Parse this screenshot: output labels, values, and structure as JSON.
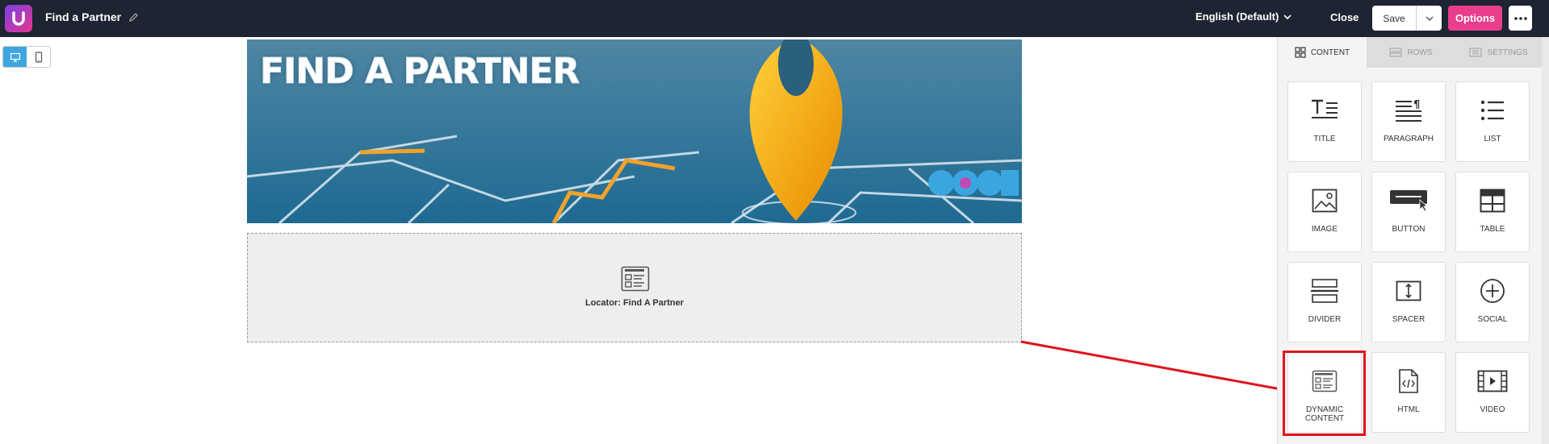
{
  "header": {
    "title": "Find a Partner",
    "language": "English (Default)",
    "close_label": "Close",
    "save_label": "Save",
    "options_label": "Options"
  },
  "banner": {
    "title": "FIND A PARTNER"
  },
  "dynamic_block": {
    "label": "Locator: Find A Partner"
  },
  "panel": {
    "tabs": [
      {
        "label": "CONTENT",
        "icon": "grid-icon",
        "active": true
      },
      {
        "label": "ROWS",
        "icon": "rows-icon",
        "active": false
      },
      {
        "label": "SETTINGS",
        "icon": "settings-icon",
        "active": false
      }
    ],
    "tiles": [
      {
        "label": "TITLE",
        "icon": "title-icon"
      },
      {
        "label": "PARAGRAPH",
        "icon": "paragraph-icon"
      },
      {
        "label": "LIST",
        "icon": "list-icon"
      },
      {
        "label": "IMAGE",
        "icon": "image-icon"
      },
      {
        "label": "BUTTON",
        "icon": "button-icon"
      },
      {
        "label": "TABLE",
        "icon": "table-icon"
      },
      {
        "label": "DIVIDER",
        "icon": "divider-icon"
      },
      {
        "label": "SPACER",
        "icon": "spacer-icon"
      },
      {
        "label": "SOCIAL",
        "icon": "social-icon"
      },
      {
        "label": "DYNAMIC CONTENT",
        "icon": "dynamic-content-icon"
      },
      {
        "label": "HTML",
        "icon": "html-icon"
      },
      {
        "label": "VIDEO",
        "icon": "video-icon"
      }
    ]
  },
  "colors": {
    "topbar": "#1e2431",
    "options": "#e83e8c",
    "device_active": "#3ea6e0",
    "highlight": "#e0121c"
  }
}
